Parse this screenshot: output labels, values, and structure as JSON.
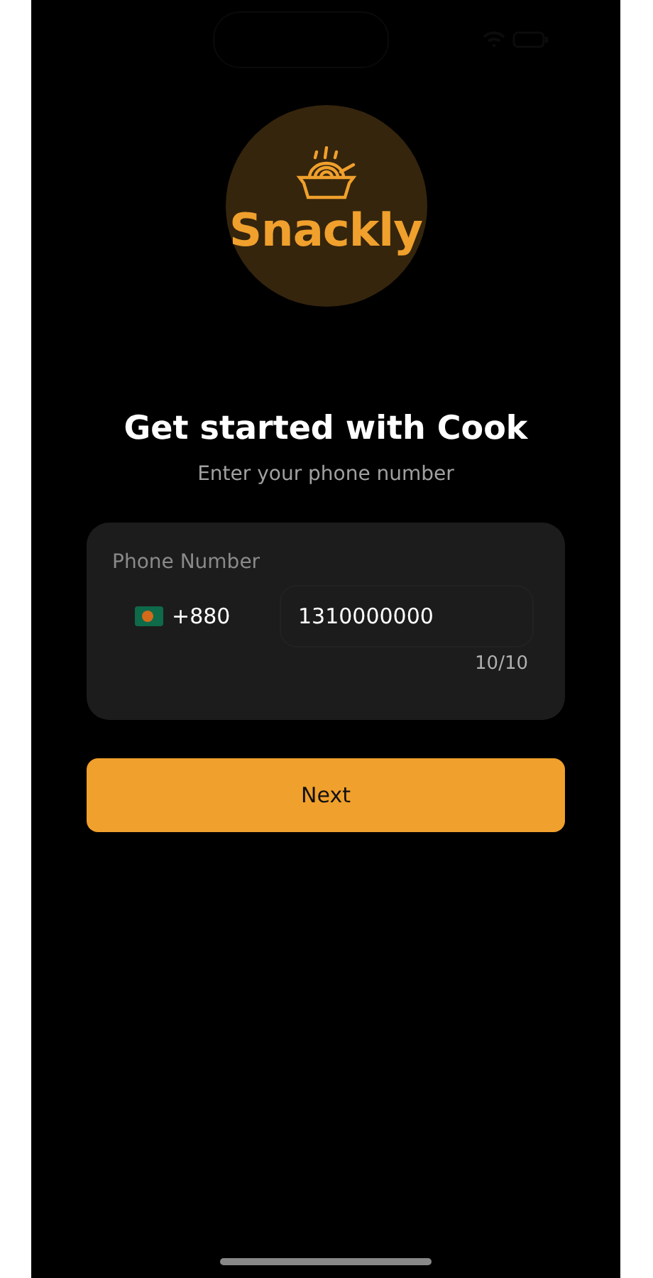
{
  "logo": {
    "name": "Snackly"
  },
  "heading": {
    "title": "Get started with Cook",
    "subtitle": "Enter your phone number"
  },
  "phone_form": {
    "label": "Phone Number",
    "country_code": "+880",
    "value": "1310000000",
    "counter": "10/10"
  },
  "buttons": [
    {
      "label": "Next"
    }
  ]
}
